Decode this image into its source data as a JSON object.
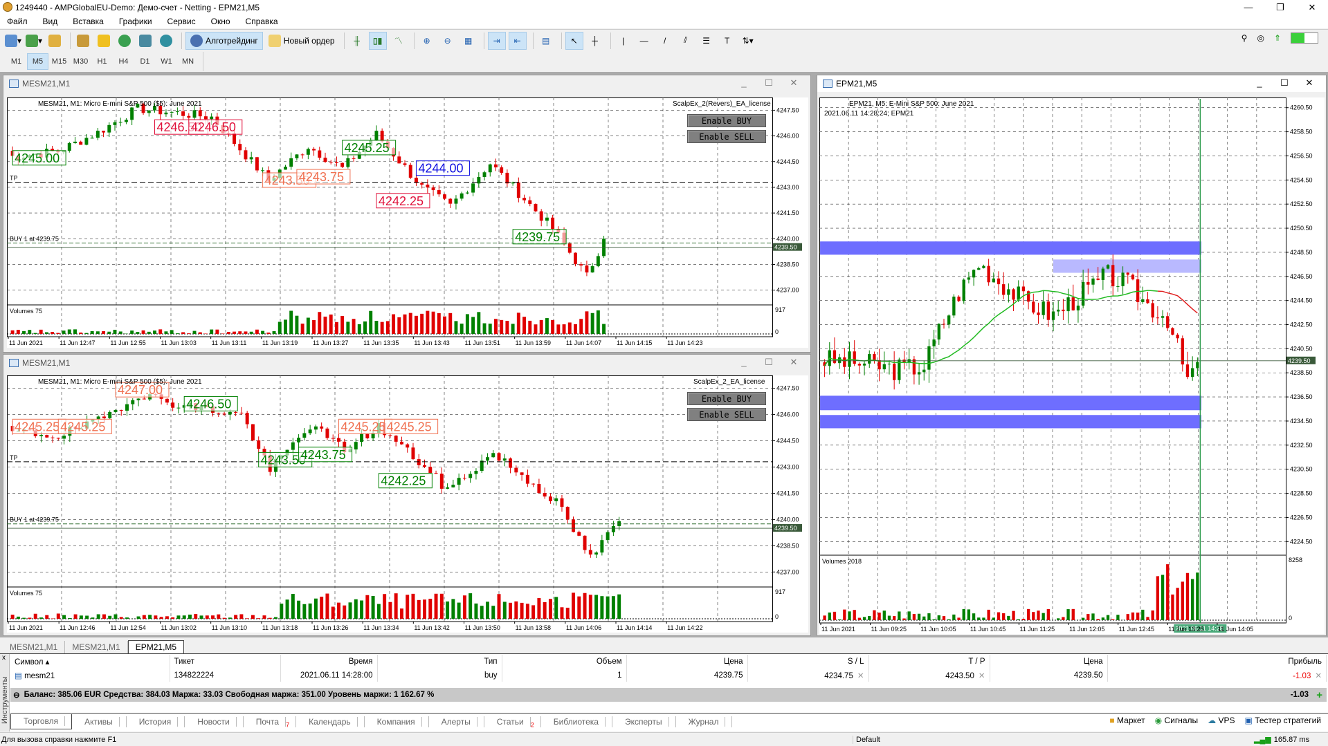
{
  "window": {
    "title": "1249440 - AMPGlobalEU-Demo: Демо-счет - Netting - EPM21,M5"
  },
  "menu": [
    "Файл",
    "Вид",
    "Вставка",
    "Графики",
    "Сервис",
    "Окно",
    "Справка"
  ],
  "toolbar": {
    "algo_label": "Алготрейдинг",
    "order_label": "Новый ордер"
  },
  "timeframes": [
    "M1",
    "M5",
    "M15",
    "M30",
    "H1",
    "H4",
    "D1",
    "W1",
    "MN"
  ],
  "active_timeframe": "M5",
  "colors": {
    "up": "#008000",
    "down": "#e00000",
    "zone_dark": "#6e6eff",
    "zone_light": "#b9b9ff",
    "ma": "#22bb22"
  },
  "charts": [
    {
      "caption": "MESM21,M1",
      "header": "MESM21, M1:  Micro E-mini S&P 500 ($5): June 2021",
      "ea": "ScalpEx_2(Revers)_EA_license",
      "btn_buy": "Enable BUY",
      "btn_sell": "Enable SELL",
      "ymin": 4236.3,
      "ymax": 4248.0,
      "ticks": [
        "4247.50",
        "4246.00",
        "4244.50",
        "4243.00",
        "4241.50",
        "4240.00",
        "4238.50",
        "4237.00"
      ],
      "price_tag": "4239.50",
      "buy_line": {
        "label": "BUY 1 at 4239.75",
        "price": 4239.75
      },
      "tp_line": {
        "label": "TP",
        "price": 4243.3
      },
      "n": 105,
      "fill": 0.78,
      "seed": 7,
      "keypoints": [
        [
          0,
          4244.8
        ],
        [
          8,
          4245.1
        ],
        [
          15,
          4246.2
        ],
        [
          22,
          4247.6
        ],
        [
          35,
          4247.1
        ],
        [
          45,
          4243.4
        ],
        [
          52,
          4245.4
        ],
        [
          58,
          4244.1
        ],
        [
          64,
          4246.1
        ],
        [
          72,
          4243.0
        ],
        [
          77,
          4241.9
        ],
        [
          84,
          4244.4
        ],
        [
          95,
          4240.6
        ],
        [
          101,
          4237.8
        ],
        [
          104,
          4240.0
        ]
      ],
      "volume_label": "Volumes 75",
      "vol_max": "917",
      "vol_min": "0",
      "vol_boost_from": 47,
      "xlabels": [
        "11 Jun 2021",
        "11 Jun 12:47",
        "11 Jun 12:55",
        "11 Jun 13:03",
        "11 Jun 13:11",
        "11 Jun 13:19",
        "11 Jun 13:27",
        "11 Jun 13:35",
        "11 Jun 13:43",
        "11 Jun 13:51",
        "11 Jun 13:59",
        "11 Jun 14:07",
        "11 Jun 14:15",
        "11 Jun 14:23"
      ],
      "labels": [
        {
          "text": "4245.00",
          "i": 0,
          "p": 4244.7,
          "color": "#008000"
        },
        {
          "text": "4246.50",
          "i": 25,
          "p": 4246.5,
          "color": "#e0103a"
        },
        {
          "text": "4246.50",
          "i": 31,
          "p": 4246.5,
          "color": "#e0103a"
        },
        {
          "text": "4243.50",
          "i": 44,
          "p": 4243.4,
          "color": "#f07050"
        },
        {
          "text": "4243.75",
          "i": 50,
          "p": 4243.6,
          "color": "#f07050"
        },
        {
          "text": "4245.25",
          "i": 58,
          "p": 4245.3,
          "color": "#008000"
        },
        {
          "text": "4244.00",
          "i": 71,
          "p": 4244.1,
          "color": "#1010e0"
        },
        {
          "text": "4242.25",
          "i": 64,
          "p": 4242.2,
          "color": "#e0103a"
        },
        {
          "text": "4239.75",
          "i": 88,
          "p": 4240.1,
          "color": "#008000"
        }
      ]
    },
    {
      "caption": "MESM21,M1",
      "header": "MESM21, M1:  Micro E-mini S&P 500 ($5): June 2021",
      "ea": "ScalpEx_2_EA_license",
      "btn_buy": "Enable BUY",
      "btn_sell": "Enable SELL",
      "ymin": 4236.3,
      "ymax": 4248.0,
      "ticks": [
        "4247.50",
        "4246.00",
        "4244.50",
        "4243.00",
        "4241.50",
        "4240.00",
        "4238.50",
        "4237.00"
      ],
      "price_tag": "4239.50",
      "buy_line": {
        "label": "BUY 1 at 4239.75",
        "price": 4239.75
      },
      "tp_line": {
        "label": "TP",
        "price": 4243.3
      },
      "n": 107,
      "fill": 0.8,
      "seed": 19,
      "keypoints": [
        [
          0,
          4245.0
        ],
        [
          8,
          4244.8
        ],
        [
          15,
          4245.6
        ],
        [
          22,
          4247.2
        ],
        [
          30,
          4246.5
        ],
        [
          40,
          4246.0
        ],
        [
          45,
          4242.8
        ],
        [
          52,
          4245.4
        ],
        [
          58,
          4244.0
        ],
        [
          64,
          4245.3
        ],
        [
          70,
          4243.6
        ],
        [
          76,
          4241.7
        ],
        [
          84,
          4243.8
        ],
        [
          95,
          4241.0
        ],
        [
          101,
          4237.8
        ],
        [
          106,
          4239.9
        ]
      ],
      "volume_label": "Volumes 75",
      "vol_max": "917",
      "vol_min": "0",
      "vol_boost_from": 47,
      "xlabels": [
        "11 Jun 2021",
        "11 Jun 12:46",
        "11 Jun 12:54",
        "11 Jun 13:02",
        "11 Jun 13:10",
        "11 Jun 13:18",
        "11 Jun 13:26",
        "11 Jun 13:34",
        "11 Jun 13:42",
        "11 Jun 13:50",
        "11 Jun 13:58",
        "11 Jun 14:06",
        "11 Jun 14:14",
        "11 Jun 14:22"
      ],
      "labels": [
        {
          "text": "4245.25",
          "i": 0,
          "p": 4245.3,
          "color": "#f07050"
        },
        {
          "text": "4245.25",
          "i": 8,
          "p": 4245.3,
          "color": "#f07050"
        },
        {
          "text": "4247.00",
          "i": 18,
          "p": 4247.4,
          "color": "#f07050"
        },
        {
          "text": "4246.50",
          "i": 30,
          "p": 4246.6,
          "color": "#008000"
        },
        {
          "text": "4243.50",
          "i": 43,
          "p": 4243.4,
          "color": "#008000"
        },
        {
          "text": "4243.75",
          "i": 50,
          "p": 4243.7,
          "color": "#008000"
        },
        {
          "text": "4245.25",
          "i": 57,
          "p": 4245.3,
          "color": "#f07050"
        },
        {
          "text": "4245.25",
          "i": 65,
          "p": 4245.3,
          "color": "#f07050"
        },
        {
          "text": "4242.25",
          "i": 64,
          "p": 4242.2,
          "color": "#008000"
        }
      ]
    },
    {
      "caption": "EPM21,M5",
      "header": "EPM21, M5:  E-Mini S&P 500: June 2021",
      "subheader": "2021.06.11 14:28:24; EPM21",
      "ymin": 4223.6,
      "ymax": 4261.0,
      "ticks": [
        "4260.50",
        "4258.50",
        "4256.50",
        "4254.50",
        "4252.50",
        "4250.50",
        "4248.50",
        "4246.50",
        "4244.50",
        "4242.50",
        "4240.50",
        "4238.50",
        "4236.50",
        "4234.50",
        "4232.50",
        "4230.50",
        "4228.50",
        "4226.50",
        "4224.50"
      ],
      "price_tag": "4239.50",
      "n": 76,
      "fill": 0.81,
      "seed": 3,
      "keypoints": [
        [
          0,
          4239.6
        ],
        [
          8,
          4239.3
        ],
        [
          14,
          4238.8
        ],
        [
          20,
          4239.1
        ],
        [
          23,
          4242.0
        ],
        [
          27,
          4245.2
        ],
        [
          31,
          4247.6
        ],
        [
          35,
          4246.2
        ],
        [
          40,
          4244.5
        ],
        [
          46,
          4243.3
        ],
        [
          52,
          4245.2
        ],
        [
          57,
          4246.6
        ],
        [
          61,
          4245.8
        ],
        [
          65,
          4244.2
        ],
        [
          69,
          4243.1
        ],
        [
          73,
          4237.9
        ],
        [
          75,
          4239.4
        ]
      ],
      "volume_label": "Volumes 2018",
      "vol_max": "8258",
      "vol_min": "0",
      "vol_boost_from": 67,
      "xlabels": [
        "11 Jun 2021",
        "11 Jun 09:25",
        "11 Jun 10:05",
        "11 Jun 10:45",
        "11 Jun 11:25",
        "11 Jun 12:05",
        "11 Jun 12:45",
        "11 Jun 13:25",
        "11 Jun 14:05"
      ],
      "time_tag": "2021.06.11 14:28",
      "zones": [
        {
          "from": 4249.4,
          "to": 4248.3,
          "start": 0,
          "tone": "zone_dark"
        },
        {
          "from": 4247.9,
          "to": 4246.8,
          "start": 46,
          "tone": "zone_light"
        },
        {
          "from": 4236.6,
          "to": 4235.4,
          "start": 0,
          "tone": "zone_dark"
        },
        {
          "from": 4235.0,
          "to": 4233.9,
          "start": 0,
          "tone": "zone_dark"
        }
      ],
      "ma_period": 20
    }
  ],
  "doc_tabs": [
    "MESM21,M1",
    "MESM21,M1",
    "EPM21,M5"
  ],
  "terminal": {
    "side_label": "Инструменты",
    "columns": [
      "Символ",
      "Тикет",
      "Время",
      "Тип",
      "Объем",
      "Цена",
      "S / L",
      "T / P",
      "Цена",
      "Прибыль"
    ],
    "rows": [
      {
        "symbol": "mesm21",
        "ticket": "134822224",
        "time": "2021.06.11 14:28:00",
        "type": "buy",
        "volume": "1",
        "open_price": "4239.75",
        "sl": "4234.75",
        "tp": "4243.50",
        "price": "4239.50",
        "profit": "-1.03"
      }
    ],
    "summary": "Баланс: 385.06 EUR  Средства: 384.03  Маржа: 33.03  Свободная маржа: 351.00  Уровень маржи: 1 162.67 %",
    "total_profit": "-1.03",
    "tabs": [
      {
        "label": "Торговля"
      },
      {
        "label": "Активы"
      },
      {
        "label": "История"
      },
      {
        "label": "Новости"
      },
      {
        "label": "Почта",
        "badge": "7"
      },
      {
        "label": "Календарь"
      },
      {
        "label": "Компания"
      },
      {
        "label": "Алерты"
      },
      {
        "label": "Статьи",
        "badge": "2"
      },
      {
        "label": "Библиотека"
      },
      {
        "label": "Эксперты"
      },
      {
        "label": "Журнал"
      }
    ],
    "services": [
      "Маркет",
      "Сигналы",
      "VPS",
      "Тестер стратегий"
    ]
  },
  "status": {
    "help": "Для вызова справки нажмите F1",
    "profile": "Default",
    "ping": "165.87 ms"
  }
}
